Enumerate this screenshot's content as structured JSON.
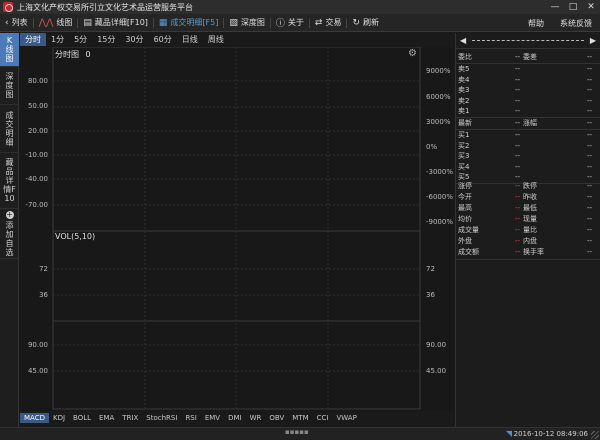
{
  "window": {
    "title": "上海文化产权交易所引立文化艺术品运营服务平台",
    "minimize": "—",
    "maximize": "□",
    "close": "✕"
  },
  "toolbar": {
    "back_label": "列表",
    "linechart_label": "线图",
    "product_detail_label": "藏品详细[F10]",
    "trade_detail_label": "成交明细[F5]",
    "depth_label": "深度图",
    "about_label": "关于",
    "trade_label": "交易",
    "refresh_label": "刷新",
    "help_label": "帮助",
    "feedback_label": "系统反馈"
  },
  "left_tabs": [
    {
      "label": "K线图"
    },
    {
      "label": "深度图"
    },
    {
      "label": "成交明细"
    },
    {
      "label": "藏品详情F10"
    },
    {
      "label": "添加自选"
    }
  ],
  "period_tabs": [
    "分时",
    "1分",
    "5分",
    "15分",
    "30分",
    "60分",
    "日线",
    "周线"
  ],
  "chart": {
    "main_label": "分时图",
    "main_value": "0",
    "vol_label": "VOL(5,10)",
    "price_ticks_left": [
      "80.00",
      "50.00",
      "20.00",
      "-10.00",
      "-40.00",
      "-70.00"
    ],
    "price_ticks_right": [
      "9000%",
      "6000%",
      "3000%",
      "0%",
      "-3000%",
      "-6000%",
      "-9000%"
    ],
    "vol_ticks_left": [
      "72",
      "36"
    ],
    "vol_ticks_right": [
      "72",
      "36"
    ],
    "sub_ticks_left": [
      "90.00",
      "45.00"
    ],
    "sub_ticks_right": [
      "90.00",
      "45.00"
    ]
  },
  "indicator_tabs": [
    "MACD",
    "KDJ",
    "BOLL",
    "EMA",
    "TRIX",
    "StochRSI",
    "RSI",
    "EMV",
    "DMI",
    "WR",
    "OBV",
    "MTM",
    "CCI",
    "VWAP"
  ],
  "order_book": {
    "rows": [
      {
        "l1": "委比",
        "v1": "--",
        "l2": "委差",
        "v2": "--"
      },
      {
        "l1": "卖5",
        "v1": "--",
        "l2": "",
        "v2": "--"
      },
      {
        "l1": "卖4",
        "v1": "--",
        "l2": "",
        "v2": "--"
      },
      {
        "l1": "卖3",
        "v1": "--",
        "l2": "",
        "v2": "--"
      },
      {
        "l1": "卖2",
        "v1": "--",
        "l2": "",
        "v2": "--"
      },
      {
        "l1": "卖1",
        "v1": "--",
        "l2": "",
        "v2": "--"
      },
      {
        "l1": "最新",
        "v1": "--",
        "l2": "涨幅",
        "v2": "--"
      },
      {
        "l1": "买1",
        "v1": "--",
        "l2": "",
        "v2": "--"
      },
      {
        "l1": "买2",
        "v1": "--",
        "l2": "",
        "v2": "--"
      },
      {
        "l1": "买3",
        "v1": "--",
        "l2": "",
        "v2": "--"
      },
      {
        "l1": "买4",
        "v1": "--",
        "l2": "",
        "v2": "--"
      },
      {
        "l1": "买5",
        "v1": "--",
        "l2": "",
        "v2": "--"
      }
    ],
    "stats": [
      {
        "l1": "涨停",
        "v1": "--",
        "l2": "跌停",
        "v2": "--"
      },
      {
        "l1": "今开",
        "v1": "--",
        "l2": "昨收",
        "v2": "--"
      },
      {
        "l1": "最高",
        "v1": "--",
        "l2": "最低",
        "v2": "--"
      },
      {
        "l1": "均价",
        "v1": "--",
        "l2": "现量",
        "v2": "--"
      },
      {
        "l1": "成交量",
        "v1": "--",
        "l2": "量比",
        "v2": "--"
      },
      {
        "l1": "外盘",
        "v1": "--",
        "l2": "内盘",
        "v2": "--"
      },
      {
        "l1": "成交额",
        "v1": "--",
        "l2": "换手率",
        "v2": "--"
      }
    ]
  },
  "status": {
    "datetime": "2016-10-12 08:49:06"
  },
  "colors": {
    "accent": "#4a7ab8",
    "down_red": "#e05050",
    "bg": "#1a1a1a"
  }
}
